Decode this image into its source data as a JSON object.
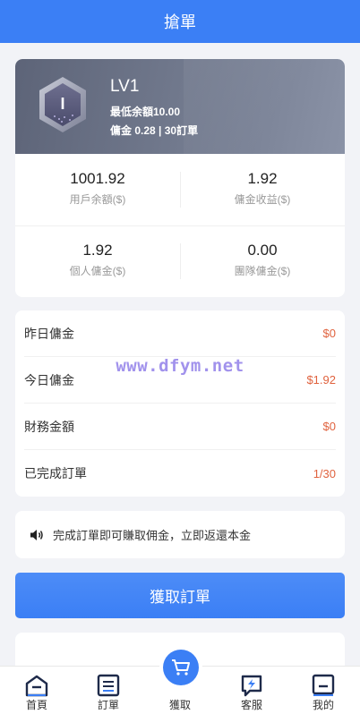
{
  "header": {
    "title": "搶單"
  },
  "level": {
    "title": "LV1",
    "badge_text": "I",
    "min_balance": "最低余額10.00",
    "commission_info": "傭金 0.28 | 30訂單"
  },
  "stats": [
    {
      "value": "1001.92",
      "label": "用戶余額($)"
    },
    {
      "value": "1.92",
      "label": "傭金收益($)"
    },
    {
      "value": "1.92",
      "label": "個人傭金($)"
    },
    {
      "value": "0.00",
      "label": "團隊傭金($)"
    }
  ],
  "summary": [
    {
      "label": "昨日傭金",
      "value": "$0"
    },
    {
      "label": "今日傭金",
      "value": "$1.92"
    },
    {
      "label": "財務金額",
      "value": "$0"
    },
    {
      "label": "已完成訂單",
      "value": "1/30"
    }
  ],
  "watermark": "www.dfym.net",
  "notice": {
    "icon": "speaker-icon",
    "text": "完成訂單即可賺取佣金，立即返還本金"
  },
  "grab_button": {
    "label": "獲取訂單"
  },
  "tabs": [
    {
      "label": "首頁",
      "icon": "home-icon"
    },
    {
      "label": "訂單",
      "icon": "orders-icon"
    },
    {
      "label": "獲取",
      "icon": "cart-icon"
    },
    {
      "label": "客服",
      "icon": "service-icon"
    },
    {
      "label": "我的",
      "icon": "profile-icon"
    }
  ],
  "colors": {
    "accent": "#3b7ff5",
    "amount": "#e0623e"
  }
}
